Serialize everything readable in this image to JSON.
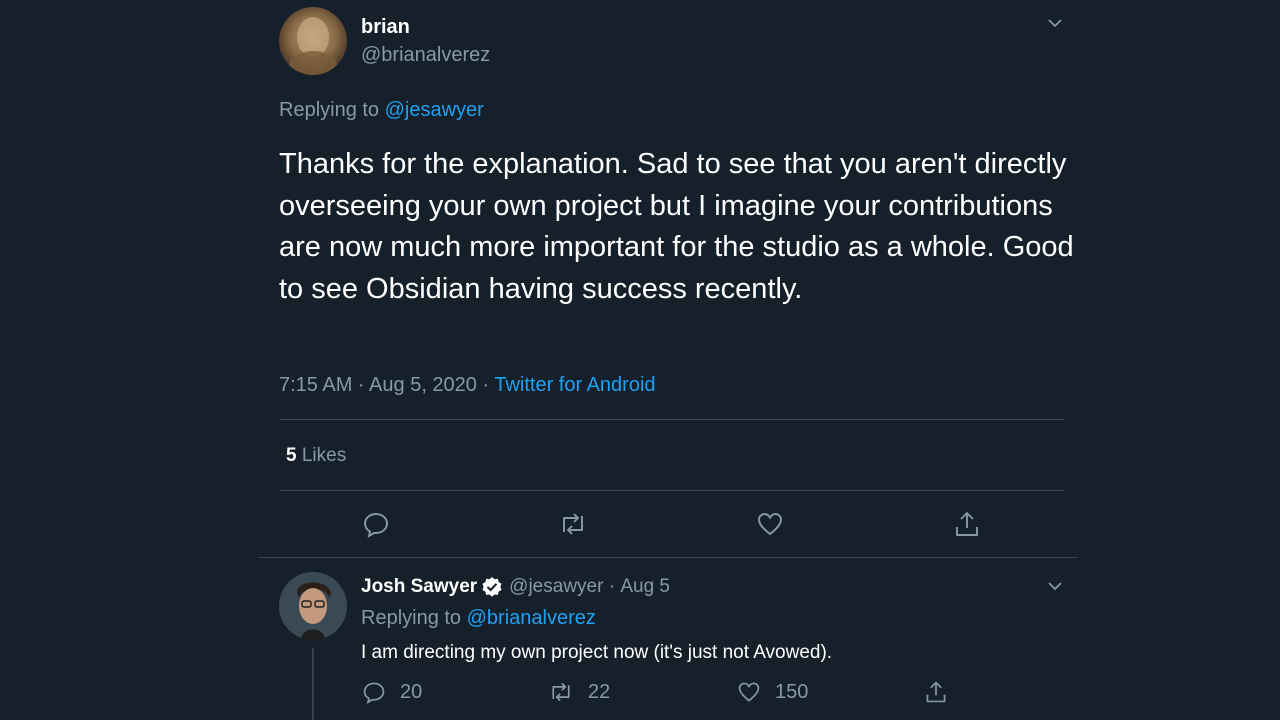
{
  "main_tweet": {
    "display_name": "brian",
    "handle": "@brianalverez",
    "replying_prefix": "Replying to",
    "replying_to": "@jesawyer",
    "text": "Thanks for the explanation. Sad to see that you aren't directly overseeing your own project but I imagine your contributions are now much more important for the studio as a whole. Good to see Obsidian having success recently.",
    "timestamp": "7:15 AM · Aug 5, 2020 · ",
    "source": "Twitter for Android",
    "likes_count": "5",
    "likes_label": "Likes"
  },
  "reply_tweet": {
    "display_name": "Josh Sawyer",
    "handle": "@jesawyer",
    "separator": " · ",
    "date": "Aug 5",
    "replying_prefix": "Replying to",
    "replying_to": "@brianalverez",
    "text": "I am directing my own project now (it's just not Avowed).",
    "reply_count": "20",
    "retweet_count": "22",
    "like_count": "150"
  },
  "icons": {
    "more": "chevron-down-icon",
    "reply": "comment-icon",
    "retweet": "retweet-icon",
    "like": "heart-icon",
    "share": "share-icon",
    "verified": "verified-badge-icon"
  },
  "colors": {
    "background": "#15202b",
    "accent": "#1da1f2",
    "muted": "#8899a6",
    "divider": "#38444d"
  }
}
